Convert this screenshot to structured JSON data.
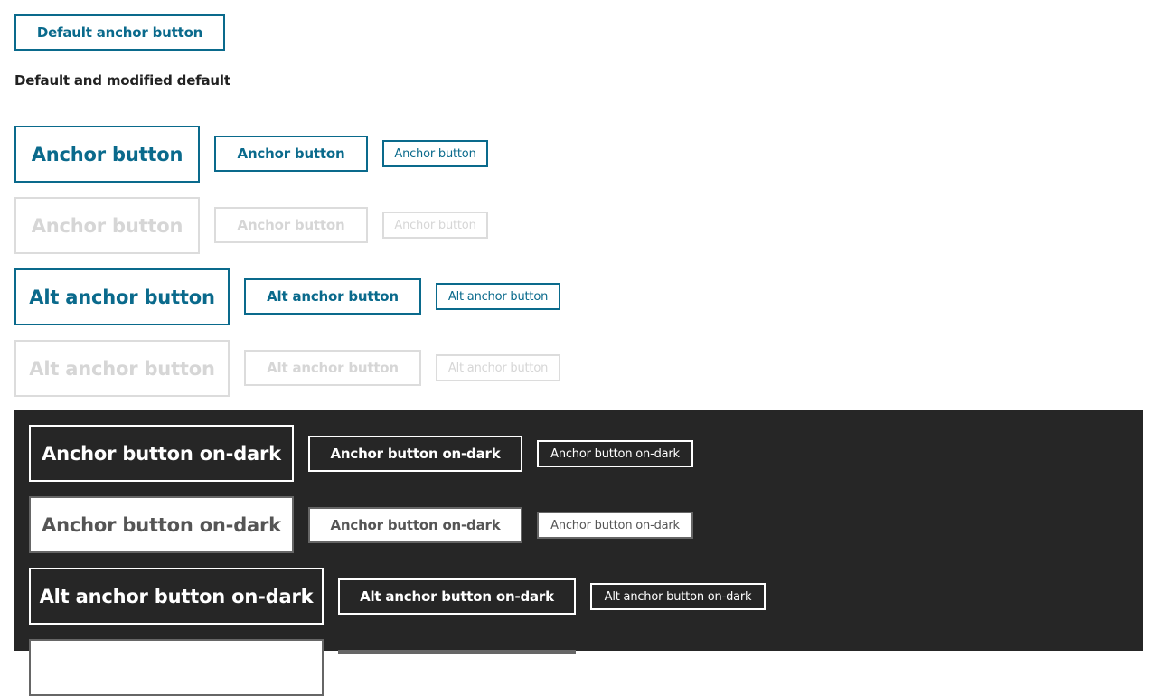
{
  "top_button": {
    "label": "Default anchor button"
  },
  "section_heading": "Default and modified default",
  "rows": {
    "anchor": {
      "label": "Anchor button"
    },
    "anchor_disabled": {
      "label": "Anchor button"
    },
    "alt": {
      "label": "Alt anchor button"
    },
    "alt_disabled": {
      "label": "Alt anchor button"
    },
    "on_dark": {
      "label": "Anchor button on-dark"
    },
    "on_dark_disabled": {
      "label": "Anchor button on-dark"
    },
    "alt_on_dark": {
      "label": "Alt anchor button on-dark"
    },
    "alt_on_dark_disabled": {
      "label": ""
    }
  },
  "colors": {
    "accent": "#0a6a8c",
    "disabled": "#d6d6d6",
    "dark_background": "#262626",
    "page_background": "#ffffff"
  }
}
